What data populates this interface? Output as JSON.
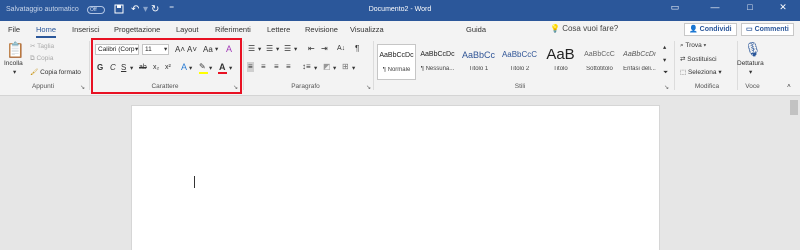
{
  "titlebar": {
    "autosave": "Salvataggio automatico",
    "autosave_state": "Off",
    "title": "Documento2 - Word",
    "quick_access": [
      "save-icon",
      "undo-icon",
      "redo-icon",
      "customize-icon"
    ],
    "window_buttons": [
      "—",
      "□",
      "✕"
    ],
    "color": "#2b579a"
  },
  "tabs": {
    "items": [
      "File",
      "Home",
      "Inserisci",
      "Progettazione",
      "Layout",
      "Riferimenti",
      "Lettere",
      "Revisione",
      "Visualizza",
      "Guida"
    ],
    "active": "Home",
    "search_placeholder": "Cosa vuoi fare?",
    "share": "Condividi",
    "comments": "Commenti"
  },
  "clipboard": {
    "label": "Appunti",
    "paste": "Incolla",
    "cut": "Taglia",
    "copy": "Copia",
    "format_painter": "Copia formato"
  },
  "font": {
    "label": "Carattere",
    "font_name": "Calibri (Corp",
    "font_size": "11",
    "bold": "G",
    "italic": "C",
    "underline": "S",
    "strikethrough": "ab",
    "subscript": "x₂",
    "superscript": "x²",
    "grow": "A˄",
    "shrink": "A˅",
    "change_case": "Aa",
    "clear": "A",
    "effects": "A",
    "highlight": "ab",
    "font_color": "A",
    "highlight_color": "#ffff00",
    "font_color_value": "#e81123"
  },
  "paragraph": {
    "label": "Paragrafo",
    "pilcrow": "¶"
  },
  "styles": {
    "label": "Stili",
    "items": [
      {
        "preview": "AaBbCcDc",
        "name": "¶ Normale"
      },
      {
        "preview": "AaBbCcDc",
        "name": "¶ Nessuna..."
      },
      {
        "preview": "AaBbCc",
        "name": "Titolo 1"
      },
      {
        "preview": "AaBbCcC",
        "name": "Titolo 2"
      },
      {
        "preview": "AaB",
        "name": "Titolo"
      },
      {
        "preview": "AaBbCcC",
        "name": "Sottotitolo"
      },
      {
        "preview": "AaBbCcDı",
        "name": "Enfasi deli..."
      }
    ]
  },
  "editing": {
    "label": "Modifica",
    "find": "Trova",
    "replace": "Sostituisci",
    "select": "Seleziona"
  },
  "voice": {
    "label": "Voce",
    "dictate": "Dettatura"
  }
}
